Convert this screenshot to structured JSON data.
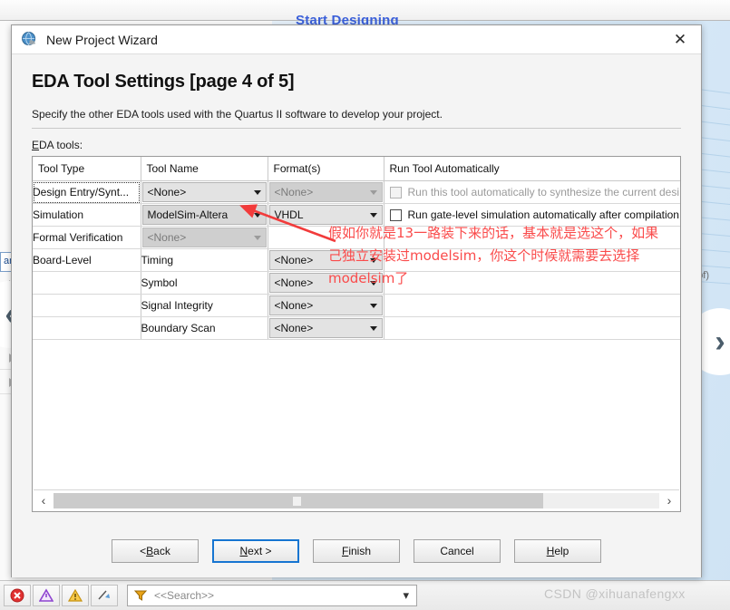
{
  "background": {
    "start_designing": "Start Designing",
    "search_strip": "arc",
    "qpf_text": ".qpf)",
    "nav_prev": "‹",
    "nav_next": "›"
  },
  "statusbar": {
    "icons": [
      "error-icon",
      "critical-warning-icon",
      "warning-icon",
      "info-icon"
    ],
    "search_placeholder": "<<Search>>",
    "filter_icon": "funnel-icon",
    "dropdown_icon": "chevron-down-icon"
  },
  "watermark": "CSDN @xihuanafengxx",
  "dialog": {
    "title": "New Project Wizard",
    "close_label": "✕",
    "page_title": "EDA Tool Settings [page 4 of 5]",
    "subtitle": "Specify the other EDA tools used with the Quartus II software to develop your project.",
    "eda_label_mnemonic": "E",
    "eda_label_rest": "DA tools:",
    "columns": [
      "Tool Type",
      "Tool Name",
      "Format(s)",
      "Run Tool Automatically"
    ],
    "rows": [
      {
        "tool_type": "Design Entry/Synt...",
        "tool_type_focused": true,
        "tool_name": "<None>",
        "tool_name_state": "enabled",
        "format": "<None>",
        "format_state": "disabled",
        "run_label": "Run this tool automatically to synthesize the current desi",
        "run_state": "disabled",
        "run_checked": false
      },
      {
        "tool_type": "Simulation",
        "tool_type_focused": false,
        "tool_name": "ModelSim-Altera",
        "tool_name_state": "selected",
        "format": "VHDL",
        "format_state": "enabled",
        "run_label": "Run gate-level simulation automatically after compilation",
        "run_state": "enabled",
        "run_checked": false
      },
      {
        "tool_type": "Formal Verification",
        "tool_type_focused": false,
        "tool_name": "<None>",
        "tool_name_state": "disabled",
        "format": "",
        "format_state": "blank",
        "run_label": "",
        "run_state": "none",
        "run_checked": false
      },
      {
        "tool_type": "Board-Level",
        "tool_type_focused": false,
        "tool_name": "Timing",
        "tool_name_state": "plain",
        "format": "<None>",
        "format_state": "enabled",
        "run_label": "",
        "run_state": "none",
        "run_checked": false
      },
      {
        "tool_type": "",
        "tool_type_focused": false,
        "tool_name": "Symbol",
        "tool_name_state": "plain",
        "format": "<None>",
        "format_state": "enabled",
        "run_label": "",
        "run_state": "none",
        "run_checked": false
      },
      {
        "tool_type": "",
        "tool_type_focused": false,
        "tool_name": "Signal Integrity",
        "tool_name_state": "plain",
        "format": "<None>",
        "format_state": "enabled",
        "run_label": "",
        "run_state": "none",
        "run_checked": false
      },
      {
        "tool_type": "",
        "tool_type_focused": false,
        "tool_name": "Boundary Scan",
        "tool_name_state": "plain",
        "format": "<None>",
        "format_state": "enabled",
        "run_label": "",
        "run_state": "none",
        "run_checked": false
      }
    ],
    "scroll": {
      "left_arrow": "‹",
      "right_arrow": "›"
    },
    "buttons": [
      {
        "name": "back",
        "pre": "< ",
        "mn": "B",
        "post": "ack",
        "default": false
      },
      {
        "name": "next",
        "pre": "",
        "mn": "N",
        "post": "ext >",
        "default": true
      },
      {
        "name": "finish",
        "pre": "",
        "mn": "F",
        "post": "inish",
        "default": false
      },
      {
        "name": "cancel",
        "pre": "",
        "mn": "",
        "post": "Cancel",
        "default": false
      },
      {
        "name": "help",
        "pre": "",
        "mn": "H",
        "post": "elp",
        "default": false
      }
    ]
  },
  "annotation": {
    "line1": "假如你就是13一路装下来的话，基本就是选这个，如果",
    "line2": "己独立安装过modelsim，你这个时候就需要去选择",
    "line3": "modelsim了",
    "arrow_color": "#f23b3b"
  }
}
